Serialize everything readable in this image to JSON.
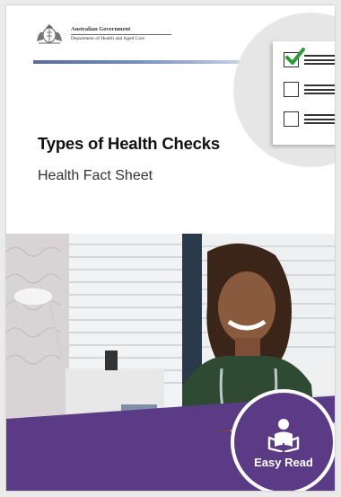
{
  "header": {
    "gov_name": "Australian Government",
    "department": "Department of Health and Aged Care"
  },
  "document": {
    "title": "Types of Health Checks",
    "subtitle": "Health Fact Sheet"
  },
  "badge": {
    "label": "Easy Read"
  },
  "colors": {
    "brand_purple": "#5b3b86",
    "check_green": "#2e9b3a",
    "stripe_blue": "#6f87b9"
  }
}
